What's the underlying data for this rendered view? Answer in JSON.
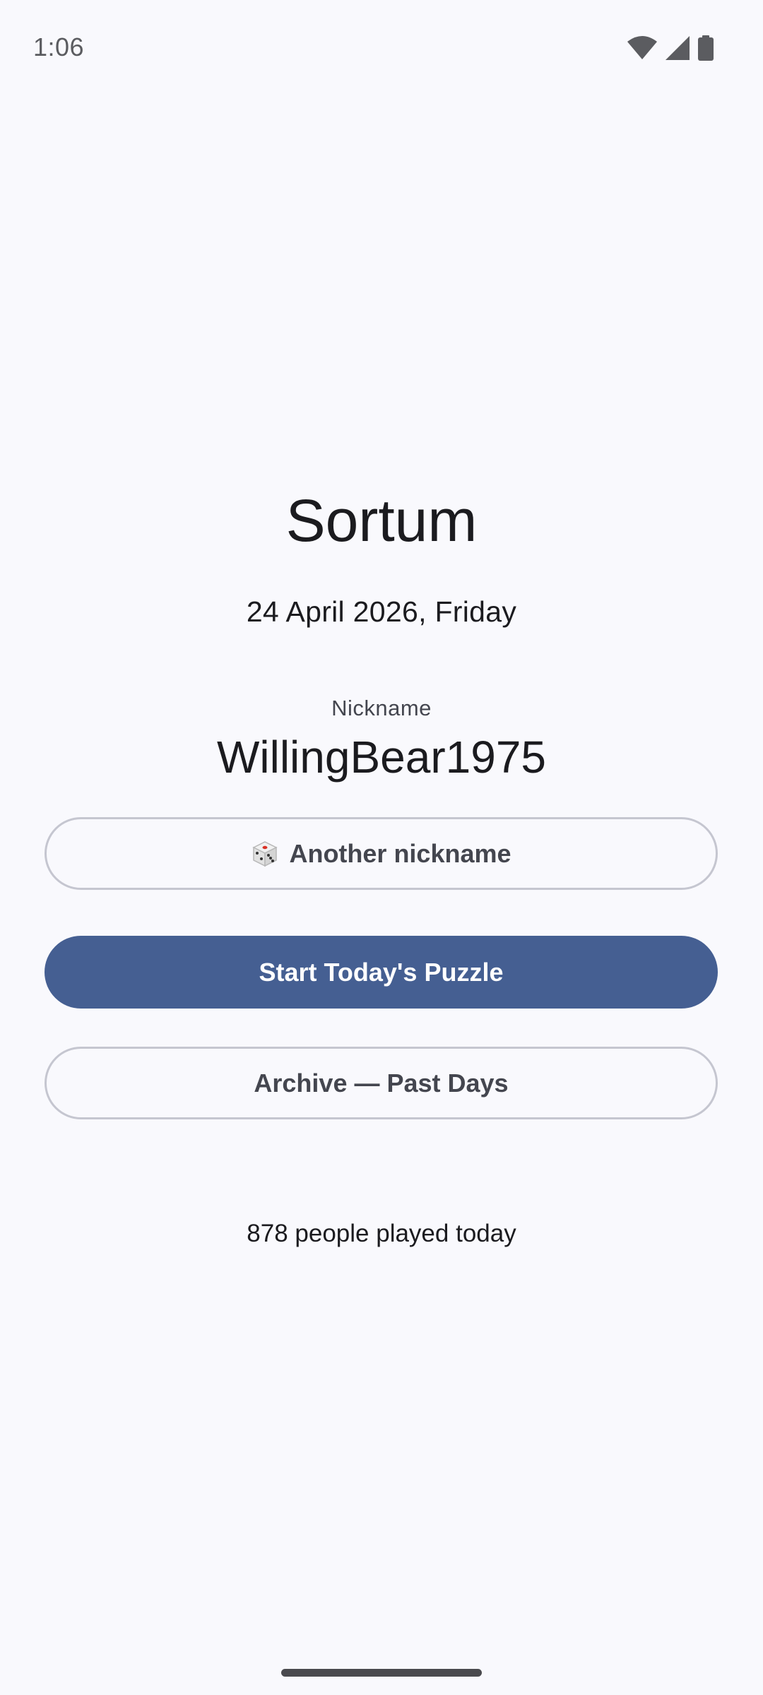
{
  "status_bar": {
    "time": "1:06",
    "icons": [
      "wifi-icon",
      "signal-icon",
      "battery-icon"
    ]
  },
  "app": {
    "title": "Sortum",
    "date": "24 April 2026, Friday"
  },
  "nickname": {
    "label": "Nickname",
    "value": "WillingBear1975",
    "another_label": "Another nickname",
    "another_icon": "dice-icon"
  },
  "actions": {
    "start_label": "Start Today's Puzzle",
    "archive_label": "Archive — Past Days"
  },
  "stats": {
    "played_text": "878 people played today"
  },
  "colors": {
    "background": "#f9f9fd",
    "primary": "#455f92",
    "outline": "#c5c6d0"
  }
}
